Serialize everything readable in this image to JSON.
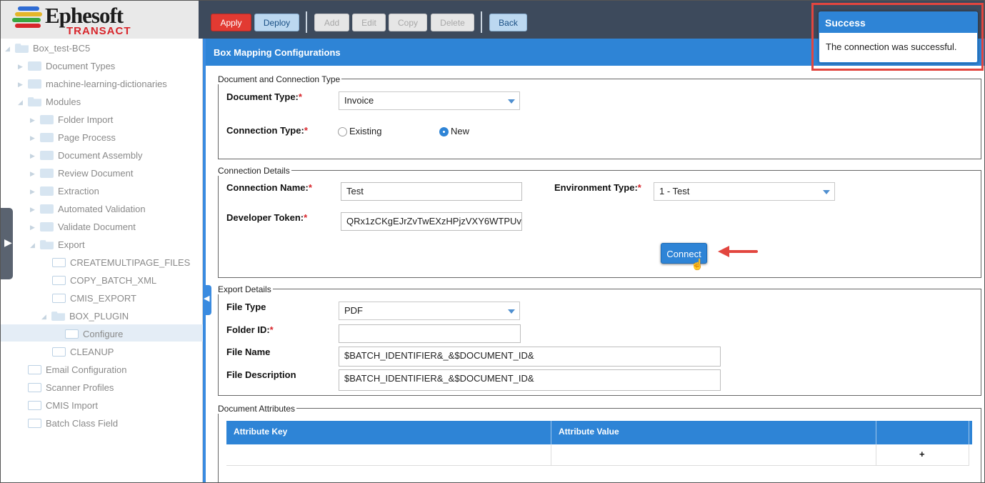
{
  "app": {
    "logo_text": "Ephesoft",
    "logo_sub": "TRANSACT",
    "accent": "#2e84d6"
  },
  "toolbar": {
    "apply": "Apply",
    "deploy": "Deploy",
    "add": "Add",
    "edit": "Edit",
    "copy": "Copy",
    "delete": "Delete",
    "back": "Back"
  },
  "tree": {
    "root": "Box_test-BC5",
    "document_types": "Document Types",
    "ml_dictionaries": "machine-learning-dictionaries",
    "modules": "Modules",
    "folder_import": "Folder Import",
    "page_process": "Page Process",
    "document_assembly": "Document Assembly",
    "review_document": "Review Document",
    "extraction": "Extraction",
    "automated_validation": "Automated Validation",
    "validate_document": "Validate Document",
    "export": "Export",
    "createmultipage": "CREATEMULTIPAGE_FILES",
    "copy_batch_xml": "COPY_BATCH_XML",
    "cmis_export": "CMIS_EXPORT",
    "box_plugin": "BOX_PLUGIN",
    "configure": "Configure",
    "cleanup": "CLEANUP",
    "email_configuration": "Email Configuration",
    "scanner_profiles": "Scanner Profiles",
    "cmis_import": "CMIS Import",
    "batch_class_field": "Batch Class Field"
  },
  "main": {
    "title": "Box Mapping Configurations"
  },
  "doc_conn": {
    "legend": "Document and Connection Type",
    "doc_type_label": "Document Type:",
    "doc_type_value": "Invoice",
    "conn_type_label": "Connection Type:",
    "opt_existing": "Existing",
    "opt_new": "New",
    "selected": "New"
  },
  "conn_details": {
    "legend": "Connection Details",
    "name_label": "Connection Name:",
    "name_value": "Test",
    "env_label": "Environment Type:",
    "env_value": "1 - Test",
    "token_label": "Developer Token:",
    "token_value": "QRx1zCKgEJrZvTwEXzHPjzVXY6WTPUv",
    "connect": "Connect"
  },
  "export_details": {
    "legend": "Export Details",
    "file_type_label": "File Type",
    "file_type_value": "PDF",
    "folder_id_label": "Folder ID:",
    "folder_id_value": "",
    "file_name_label": "File Name",
    "file_name_value": "$BATCH_IDENTIFIER&_&$DOCUMENT_ID&",
    "file_desc_label": "File Description",
    "file_desc_value": "$BATCH_IDENTIFIER&_&$DOCUMENT_ID&"
  },
  "doc_attrs": {
    "legend": "Document Attributes",
    "col_key": "Attribute Key",
    "col_value": "Attribute Value",
    "add": "+"
  },
  "toast": {
    "title": "Success",
    "message": "The connection was successful."
  },
  "required_mark": "*"
}
